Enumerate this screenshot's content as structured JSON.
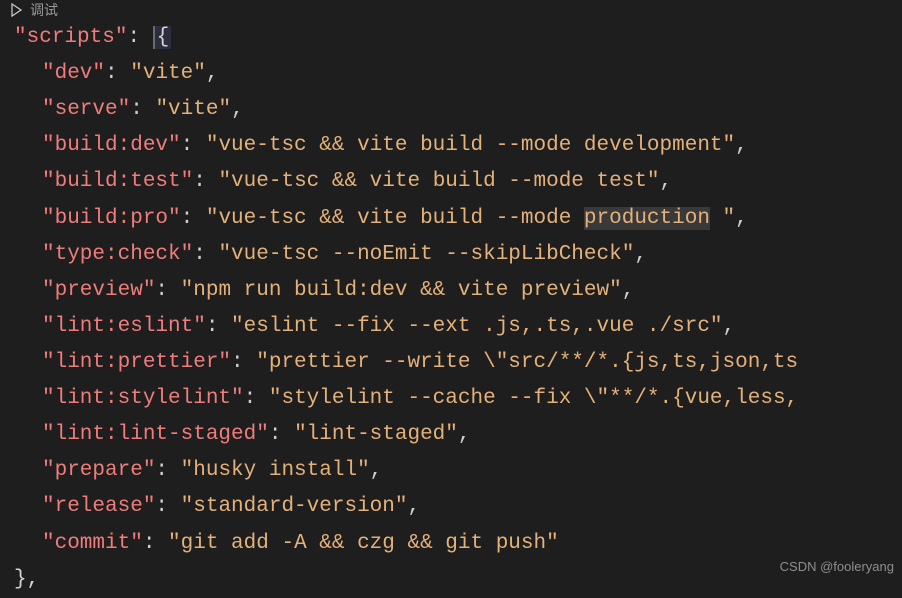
{
  "debug_label": "调试",
  "root_key": "scripts",
  "entries": [
    {
      "key": "dev",
      "value": "vite",
      "comma": true
    },
    {
      "key": "serve",
      "value": "vite",
      "comma": true
    },
    {
      "key": "build:dev",
      "value": "vue-tsc && vite build --mode development",
      "comma": true
    },
    {
      "key": "build:test",
      "value": "vue-tsc && vite build --mode test",
      "comma": true
    },
    {
      "key": "build:pro",
      "value_pre": "vue-tsc && vite build --mode ",
      "value_hl": "production",
      "value_post": " ",
      "comma": true
    },
    {
      "key": "type:check",
      "value": "vue-tsc --noEmit --skipLibCheck",
      "comma": true
    },
    {
      "key": "preview",
      "value": "npm run build:dev && vite preview",
      "comma": true
    },
    {
      "key": "lint:eslint",
      "value": "eslint --fix --ext .js,.ts,.vue ./src",
      "comma": true
    },
    {
      "key": "lint:prettier",
      "value": "prettier --write \\\"src/**/*.{js,ts,json,ts",
      "comma": false,
      "truncated": true
    },
    {
      "key": "lint:stylelint",
      "value": "stylelint --cache --fix \\\"**/*.{vue,less,",
      "comma": false,
      "truncated": true
    },
    {
      "key": "lint:lint-staged",
      "value": "lint-staged",
      "comma": true
    },
    {
      "key": "prepare",
      "value": "husky install",
      "comma": true
    },
    {
      "key": "release",
      "value": "standard-version",
      "comma": true
    },
    {
      "key": "commit",
      "value": "git add -A && czg && git push",
      "comma": false
    }
  ],
  "closing": "},",
  "watermark": "CSDN @fooleryang"
}
